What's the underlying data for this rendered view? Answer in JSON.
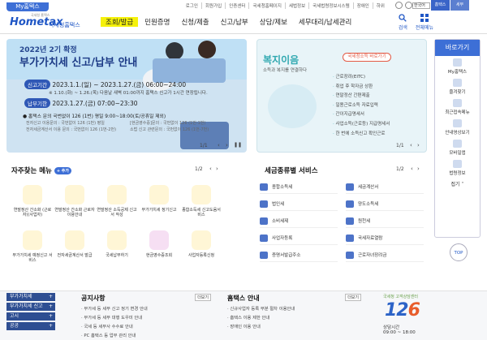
{
  "topbar": {
    "my_button": "My홈택스",
    "util_links": [
      "로그인",
      "회원가입",
      "인증센터",
      "국세청홈페이지",
      "세법정보",
      "국세법령정보시스템",
      "장애인",
      "하위"
    ],
    "lang_select": "한국어",
    "top_icons": [
      "홈택스",
      "세무"
    ]
  },
  "header": {
    "logo_main": "Hometax",
    "logo_text": "국세청홈택스",
    "logo_sub": "국세청 홈택스",
    "menu": [
      "조회/발급",
      "민원증명",
      "신청/제출",
      "신고/납부",
      "상담/제보",
      "세무대리/납세관리"
    ],
    "search_label": "검색",
    "sitemap_label": "전체메뉴"
  },
  "banner": {
    "heading": "2022년 2기 확정",
    "title": "부가가치세 신고/납부 안내",
    "period1_tag": "신고기간",
    "period1_text": "2023.1.1.(일) ~ 2023.1.27.(금) 06:00~24:00",
    "period1_note": "※ 1.10.(화) ~ 1.26.(목) 다음날 새벽 01:00까지 홈택스 신고가 1시간 연장됩니다.",
    "period2_tag": "납부기한",
    "period2_text": "2023.1.27.(금) 07:00~23:30",
    "contact_text": "● 홈택스 문의 국번없이 126 (1번) 평일 9:00~18:00(토/공휴일 제외)",
    "contact_detail1": "전자신고 이용문의 : 국번없이 126 (1번) 평일",
    "contact_detail2": "전자세금계산서 이용 문의 : 국번없이 126 (1번-2번)",
    "contact_detail3": "[현금영수증]문의 : 국번없이 126 (1번-1번)",
    "contact_detail4": "소법 신고 관련문의 : 국번없이 126 (1번-7번)",
    "pager": "1/1"
  },
  "welfare": {
    "title": "복지이음",
    "subtitle": "소득과 복지를 연결하다",
    "button": "국세청소득 바로가기",
    "items": [
      "근로장려(EITC)",
      "취업 후 학자금 상환",
      "연말정산 간편제출",
      "일용근로소득 자료입력",
      "간이지급명세서",
      "사업소득(근로등) 지급명세서",
      "한 번에 소득신고 확인근로"
    ],
    "pager": "1/1"
  },
  "right_nav": {
    "header": "바로가기",
    "items": [
      "My홈택스",
      "즐겨찾기",
      "최근접속메뉴",
      "안내영상보기",
      "모바일앱",
      "법령정보"
    ],
    "footer": "접기"
  },
  "top_button": "TOP",
  "freq_menu": {
    "title": "자주찾는 메뉴",
    "add_label": "+ 추가",
    "pager": "1/2",
    "items": [
      "연말정산 간소화 (근로자)(사업자)",
      "연말정산 간소화 근로자 이용안내",
      "연말정산 소득공제 신고서 작성",
      "부가가치세 정기신고",
      "종합소득세 신고도움서비스",
      "부가가치세 예정신고 서비스",
      "전자세금계산서 발급",
      "국세납부하기",
      "현금영수증조회",
      "사업자등록신청"
    ]
  },
  "tax_services": {
    "title": "세금종류별 서비스",
    "pager": "1/2",
    "items": [
      "종합소득세",
      "세금계산서",
      "법인세",
      "양도소득세",
      "소비세제",
      "원천세",
      "사업자등록",
      "국세자료열람",
      "증명서발급주소",
      "근로자녀장려금"
    ]
  },
  "footer": {
    "quick_links": [
      "부가가치세",
      "부가가치세 신고",
      "고시",
      "공공"
    ],
    "notice": {
      "title": "공지사항",
      "more": "더보기",
      "lines": [
        "부가세 등 세무 신고 정기 변경 안내",
        "부가세 등 세무 대행 도우미 안내",
        "국세 등 세무사 수수료 안내",
        "PC 홈택스 등 업무 관리 안내"
      ]
    },
    "guide": {
      "title": "홈택스 안내",
      "more": "더보기",
      "lines": [
        "신규사업자 등록 부분 절차 이용안내",
        "홈택스 이용 제한 안내",
        "장애인 이용 안내"
      ]
    },
    "callcenter": {
      "slogan": "국세청 고객상담센터",
      "number_a": "12",
      "number_b": "6",
      "hours_label": "상담시간",
      "hours": "09:00 ~ 18:00"
    }
  },
  "colors": {
    "brand_blue": "#3d6fd6",
    "nav_highlight": "#f5f10a",
    "welfare_teal": "#2fa8b0",
    "footer_navy": "#2e4e92"
  }
}
